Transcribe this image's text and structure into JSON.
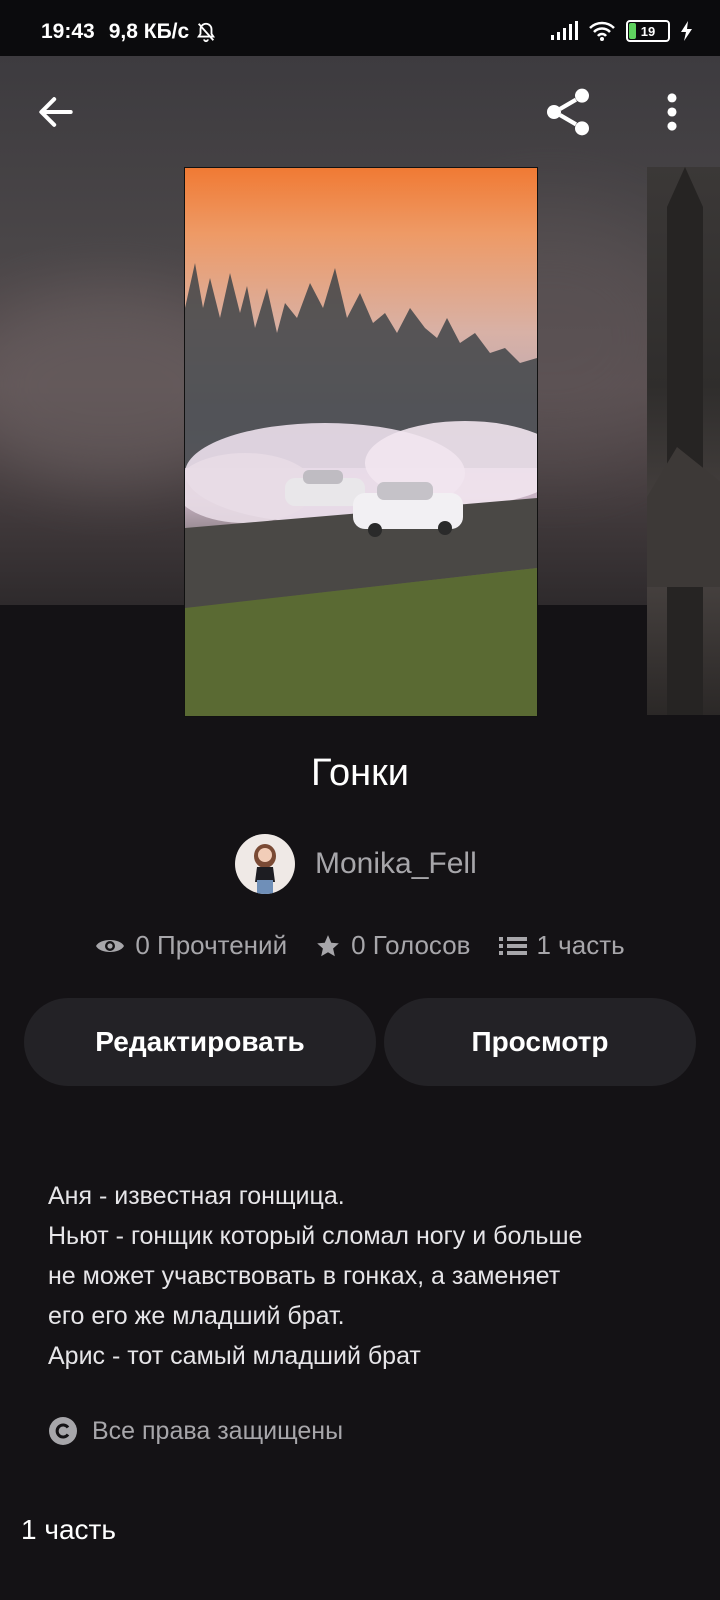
{
  "status_bar": {
    "time": "19:43",
    "network_speed": "9,8 КБ/с",
    "battery_level": "19",
    "icons": [
      "bell-off-icon",
      "signal-icon",
      "wifi-icon",
      "battery-icon",
      "charging-icon"
    ]
  },
  "top_bar": {
    "icons": [
      "back-arrow-icon",
      "share-icon",
      "more-vertical-icon"
    ]
  },
  "story": {
    "title": "Гонки",
    "author": "Monika_Fell",
    "reads": "0 Прочтений",
    "votes": "0 Голосов",
    "parts": "1 часть"
  },
  "actions": {
    "edit_label": "Редактировать",
    "view_label": "Просмотр"
  },
  "description": [
    "Аня - известная гонщица.",
    "Ньют - гонщик который сломал ногу и больше",
    "не может учавствовать в гонках, а заменяет",
    "его его же младший брат.",
    "Арис - тот самый младший брат"
  ],
  "copyright": "Все права защищены",
  "parts_section": {
    "title": "1 часть"
  },
  "colors": {
    "background": "#141215",
    "button_bg": "#232226",
    "muted_text": "#a7a6aa"
  }
}
